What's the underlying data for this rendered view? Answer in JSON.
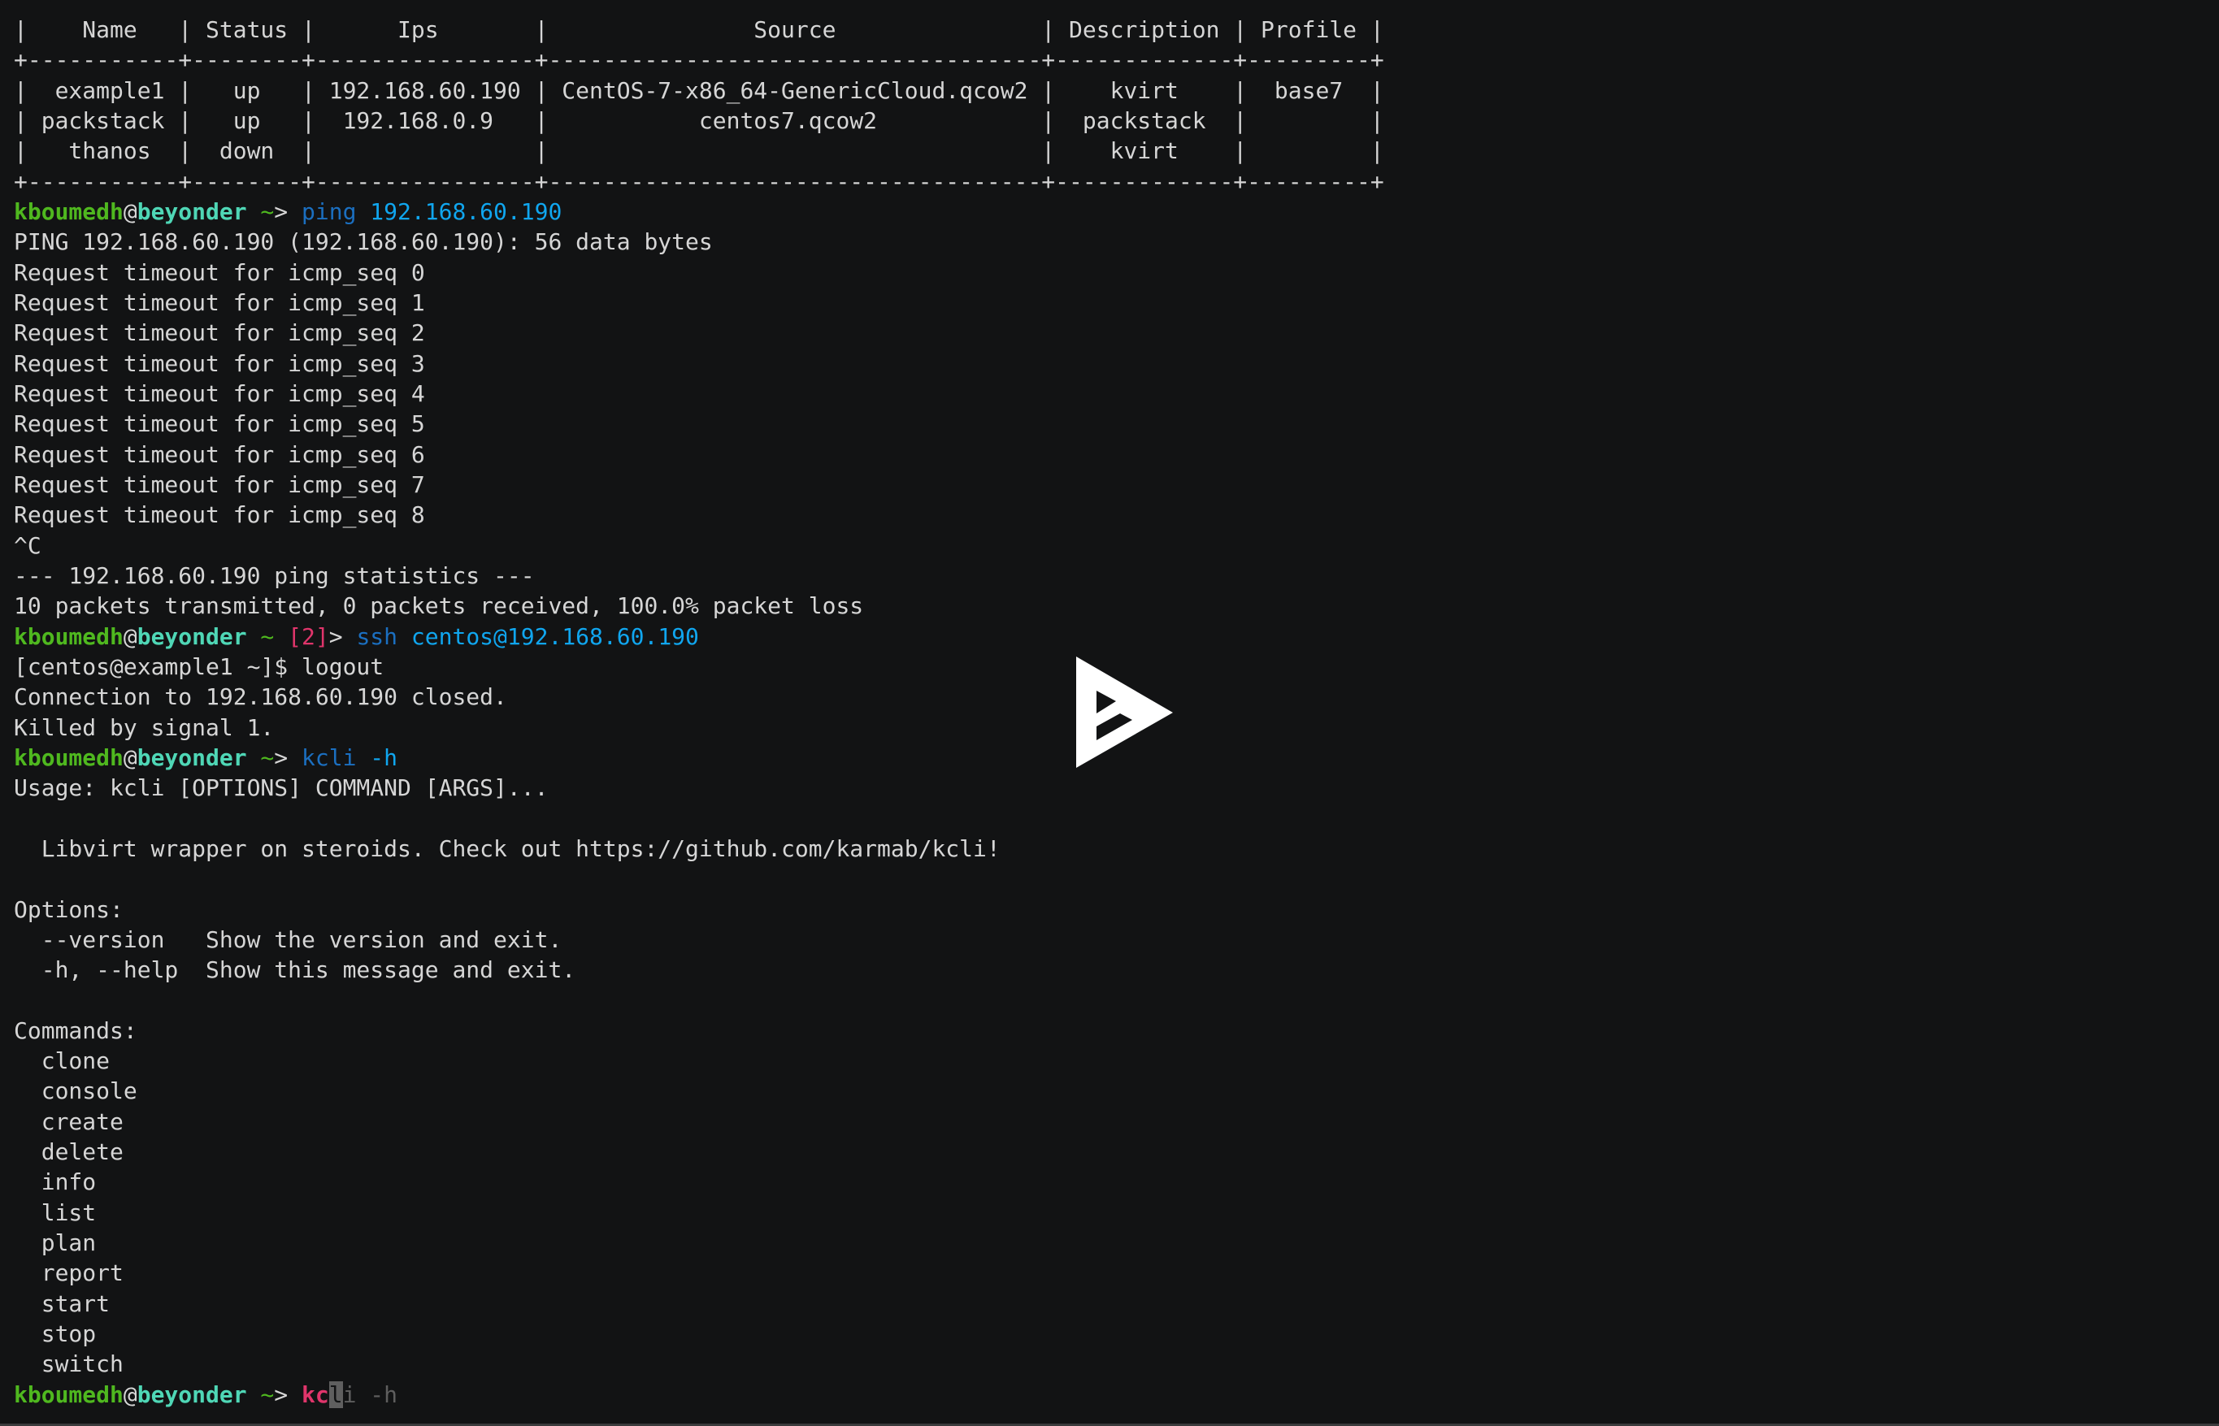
{
  "terminal": {
    "lines": [
      [
        [
          "|    Name   | Status |      Ips       |               Source               | Description | Profile |",
          "txt"
        ]
      ],
      [
        [
          "+-----------+--------+----------------+------------------------------------+-------------+---------+",
          "txt"
        ]
      ],
      [
        [
          "|  example1 |   up   | 192.168.60.190 | CentOS-7-x86_64-GenericCloud.qcow2 |    kvirt    |  base7  |",
          "txt"
        ]
      ],
      [
        [
          "| packstack |   up   |  192.168.0.9   |           centos7.qcow2            |  packstack  |         |",
          "txt"
        ]
      ],
      [
        [
          "|   thanos  |  down  |                |                                    |    kvirt    |         |",
          "txt"
        ]
      ],
      [
        [
          "+-----------+--------+----------------+------------------------------------+-------------+---------+",
          "txt"
        ]
      ],
      [
        [
          "kboumedh",
          "user"
        ],
        [
          "@",
          "at"
        ],
        [
          "beyonder",
          "host"
        ],
        [
          " ~",
          "tilde"
        ],
        [
          "> ",
          "arrow"
        ],
        [
          "ping",
          "cmd"
        ],
        [
          " 192.168.60.190",
          "arg"
        ]
      ],
      [
        [
          "PING 192.168.60.190 (192.168.60.190): 56 data bytes",
          "txt"
        ]
      ],
      [
        [
          "Request timeout for icmp_seq 0",
          "txt"
        ]
      ],
      [
        [
          "Request timeout for icmp_seq 1",
          "txt"
        ]
      ],
      [
        [
          "Request timeout for icmp_seq 2",
          "txt"
        ]
      ],
      [
        [
          "Request timeout for icmp_seq 3",
          "txt"
        ]
      ],
      [
        [
          "Request timeout for icmp_seq 4",
          "txt"
        ]
      ],
      [
        [
          "Request timeout for icmp_seq 5",
          "txt"
        ]
      ],
      [
        [
          "Request timeout for icmp_seq 6",
          "txt"
        ]
      ],
      [
        [
          "Request timeout for icmp_seq 7",
          "txt"
        ]
      ],
      [
        [
          "Request timeout for icmp_seq 8",
          "txt"
        ]
      ],
      [
        [
          "^C",
          "txt"
        ]
      ],
      [
        [
          "--- 192.168.60.190 ping statistics ---",
          "txt"
        ]
      ],
      [
        [
          "10 packets transmitted, 0 packets received, 100.0% packet loss",
          "txt"
        ]
      ],
      [
        [
          "kboumedh",
          "user"
        ],
        [
          "@",
          "at"
        ],
        [
          "beyonder",
          "host"
        ],
        [
          " ~ ",
          "tilde"
        ],
        [
          "[2]",
          "code"
        ],
        [
          "> ",
          "arrow"
        ],
        [
          "ssh",
          "cmd"
        ],
        [
          " centos@192.168.60.190",
          "arg"
        ]
      ],
      [
        [
          "[centos@example1 ~]$ logout",
          "txt"
        ]
      ],
      [
        [
          "Connection to 192.168.60.190 closed.",
          "txt"
        ]
      ],
      [
        [
          "Killed by signal 1.",
          "txt"
        ]
      ],
      [
        [
          "kboumedh",
          "user"
        ],
        [
          "@",
          "at"
        ],
        [
          "beyonder",
          "host"
        ],
        [
          " ~",
          "tilde"
        ],
        [
          "> ",
          "arrow"
        ],
        [
          "kcli",
          "cmd"
        ],
        [
          " -h",
          "arg"
        ]
      ],
      [
        [
          "Usage: kcli [OPTIONS] COMMAND [ARGS]...",
          "txt"
        ]
      ],
      [
        [
          "",
          "txt"
        ]
      ],
      [
        [
          "  Libvirt wrapper on steroids. Check out https://github.com/karmab/kcli!",
          "txt"
        ]
      ],
      [
        [
          "",
          "txt"
        ]
      ],
      [
        [
          "Options:",
          "txt"
        ]
      ],
      [
        [
          "  --version   Show the version and exit.",
          "txt"
        ]
      ],
      [
        [
          "  -h, --help  Show this message and exit.",
          "txt"
        ]
      ],
      [
        [
          "",
          "txt"
        ]
      ],
      [
        [
          "Commands:",
          "txt"
        ]
      ],
      [
        [
          "  clone",
          "txt"
        ]
      ],
      [
        [
          "  console",
          "txt"
        ]
      ],
      [
        [
          "  create",
          "txt"
        ]
      ],
      [
        [
          "  delete",
          "txt"
        ]
      ],
      [
        [
          "  info",
          "txt"
        ]
      ],
      [
        [
          "  list",
          "txt"
        ]
      ],
      [
        [
          "  plan",
          "txt"
        ]
      ],
      [
        [
          "  report",
          "txt"
        ]
      ],
      [
        [
          "  start",
          "txt"
        ]
      ],
      [
        [
          "  stop",
          "txt"
        ]
      ],
      [
        [
          "  switch",
          "txt"
        ]
      ],
      [
        [
          "kboumedh",
          "user"
        ],
        [
          "@",
          "at"
        ],
        [
          "beyonder",
          "host"
        ],
        [
          " ~",
          "tilde"
        ],
        [
          "> ",
          "arrow"
        ],
        [
          "kc",
          "typed"
        ],
        [
          "l",
          "cursor"
        ],
        [
          "i -h",
          "sugg"
        ]
      ]
    ]
  },
  "player": {
    "icon": "asciinema-play-icon"
  },
  "colors": {
    "background": "#121314",
    "user": "#4fb81f",
    "host": "#4fd7b6",
    "command": "#1b6fc0",
    "argument": "#10a6ef",
    "error": "#e0356b"
  }
}
